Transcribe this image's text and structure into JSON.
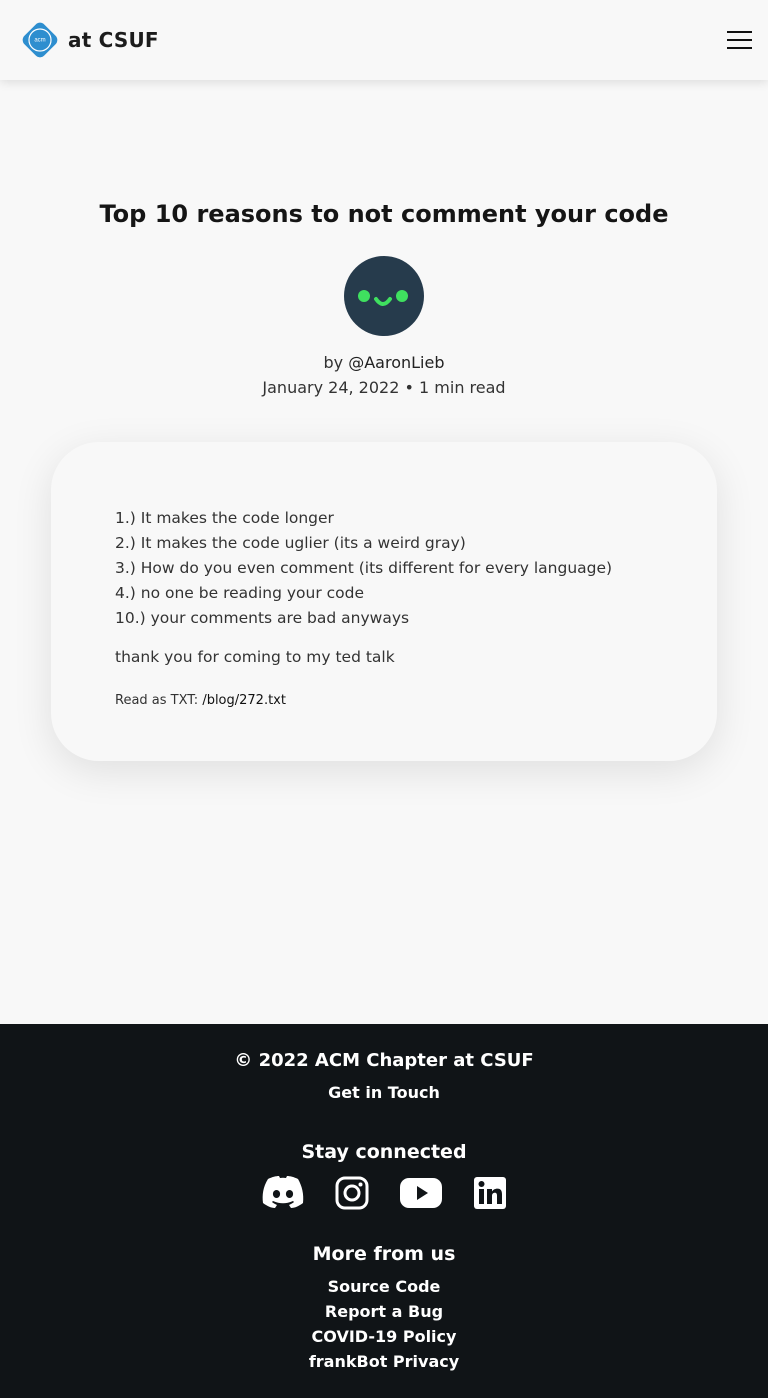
{
  "header": {
    "logo_text": "acm",
    "brand_text": "at CSUF",
    "menu_icon": "hamburger-menu-icon"
  },
  "post": {
    "title": "Top 10 reasons to not comment your code",
    "by_prefix": "by ",
    "author": "@AaronLieb",
    "date": "January 24, 2022",
    "separator": " • ",
    "read_time": "1 min read",
    "items": [
      "1.) It makes the code longer",
      "2.) It makes the code uglier (its a weird gray)",
      "3.) How do you even comment (its different for every language)",
      "4.) no one be reading your code",
      "10.) your comments are bad anyways"
    ],
    "closing": "thank you for coming to my ted talk",
    "txt_label": "Read as TXT: ",
    "txt_path": "/blog/272.txt"
  },
  "footer": {
    "copyright": "© 2022 ACM Chapter at CSUF",
    "get_in_touch": "Get in Touch",
    "stay_connected": "Stay connected",
    "social_icons": [
      "discord-icon",
      "instagram-icon",
      "youtube-icon",
      "linkedin-icon"
    ],
    "more_from_us": "More from us",
    "links": [
      "Source Code",
      "Report a Bug",
      "COVID-19 Policy",
      "frankBot Privacy"
    ]
  },
  "colors": {
    "background": "#f8f8f8",
    "footer_bg": "#101417",
    "logo_blue": "#2e8ecf",
    "avatar_bg": "#263b4c",
    "avatar_face": "#3fe05f"
  }
}
